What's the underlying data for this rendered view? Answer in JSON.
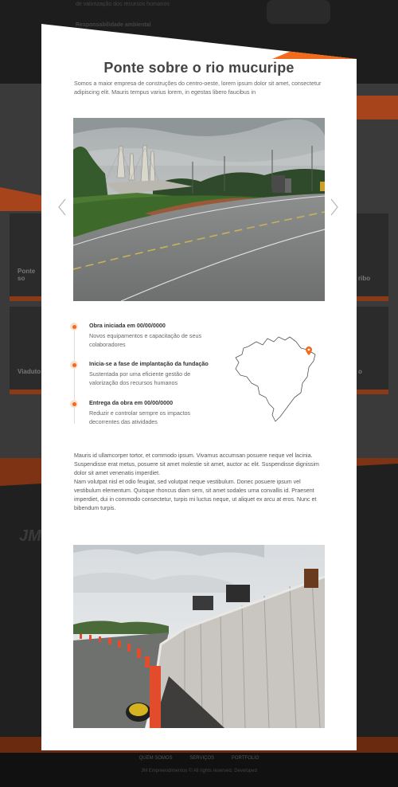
{
  "background": {
    "top_line_1": "de valorização dos recursos humanos",
    "top_line_2": "Responsabilidade ambiental",
    "card_left_1": "Ponte so",
    "card_left_2": "Viaduto",
    "card_right_1": "ribo",
    "card_right_2": "o",
    "logo": "JM",
    "footer_links": [
      "QUEM SOMOS",
      "SERVIÇOS",
      "PORTFOLIO"
    ],
    "footer_copy": "JM Empreendimentos © All rights reserved. Developed"
  },
  "modal": {
    "title": "Ponte sobre o rio mucuripe",
    "intro": "Somos a maior empresa de construções do centro-oeste, lorem ipsum dolor sit amet, consectetur adipiscing elit. Mauris tempus varius lorem, in egestas libero faucibus in",
    "close_icon": "close-icon",
    "accent_color": "#f26a1b",
    "timeline": [
      {
        "title": "Obra iniciada em 00/00/0000",
        "text": "Novos equipamentos e capacitação de seus colaboradores"
      },
      {
        "title": "Inicia-se a fase de implantação da fundação",
        "text": "Sustentada por uma eficiente gestão de valorização dos recursos humanos"
      },
      {
        "title": "Entrega da obra em 00/00/0000",
        "text": "Reduzir e controlar sempre os impactos decorrentes das atividades"
      }
    ],
    "map_icon": "brazil-map-pin-icon",
    "body_paragraph_1": "Mauris id ullamcorper tortor, et commodo ipsum. Vivamus accumsan posuere neque vel lacinia. Suspendisse erat metus, posuere sit amet molestie sit amet, auctor ac elit. Suspendisse dignissim dolor sit amet venenatis imperdiet.",
    "body_paragraph_2": "Nam volutpat nisl et odio feugiat, sed volutpat neque vestibulum. Donec posuere ipsum vel vestibulum elementum. Quisque rhoncus diam sem, sit amet sodales urna convallis id. Praesent imperdiet, dui in commodo consectetur, turpis mi luctus neque, ut aliquet ex arcu at eros. Nunc et bibendum turpis."
  }
}
